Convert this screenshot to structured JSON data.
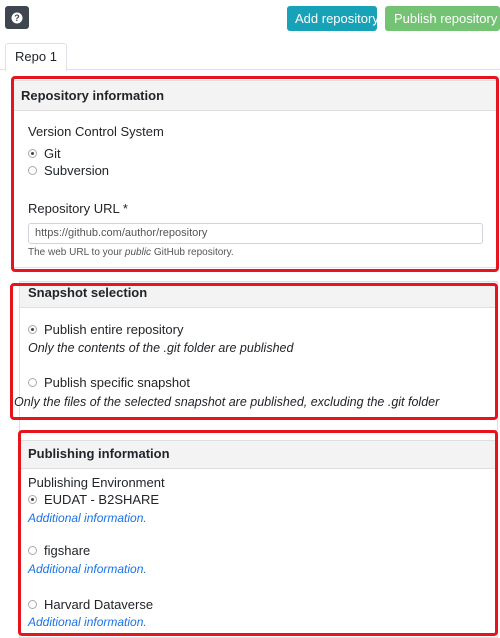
{
  "toolbar": {
    "help_icon": "question-icon",
    "add_label": "Add repository",
    "publish_label": "Publish repository",
    "add_color": "#17a2b8",
    "publish_color": "#5cb85c"
  },
  "tabs": [
    {
      "label": "Repo 1",
      "active": true
    }
  ],
  "repository_info": {
    "title": "Repository information",
    "vcs_label": "Version Control System",
    "vcs_options": [
      {
        "label": "Git",
        "checked": true
      },
      {
        "label": "Subversion",
        "checked": false
      }
    ],
    "url_label": "Repository URL *",
    "url_placeholder": "https://github.com/author/repository",
    "url_help_prefix": "The web URL to your ",
    "url_help_emph": "public",
    "url_help_suffix": " GitHub repository."
  },
  "snapshot": {
    "title": "Snapshot selection",
    "options": [
      {
        "label": "Publish entire repository",
        "checked": true,
        "description": "Only the contents of the .git folder are published"
      },
      {
        "label": "Publish specific snapshot",
        "checked": false,
        "description": "Only the files of the selected snapshot are published, excluding the .git folder"
      }
    ]
  },
  "publishing": {
    "title": "Publishing information",
    "env_label": "Publishing Environment",
    "options": [
      {
        "label": "EUDAT - B2SHARE",
        "checked": true,
        "link": "Additional information."
      },
      {
        "label": "figshare",
        "checked": false,
        "link": "Additional information."
      },
      {
        "label": "Harvard Dataverse",
        "checked": false,
        "link": "Additional information."
      }
    ]
  },
  "colors": {
    "highlight": "#e5141d",
    "link": "#1a73e8"
  }
}
